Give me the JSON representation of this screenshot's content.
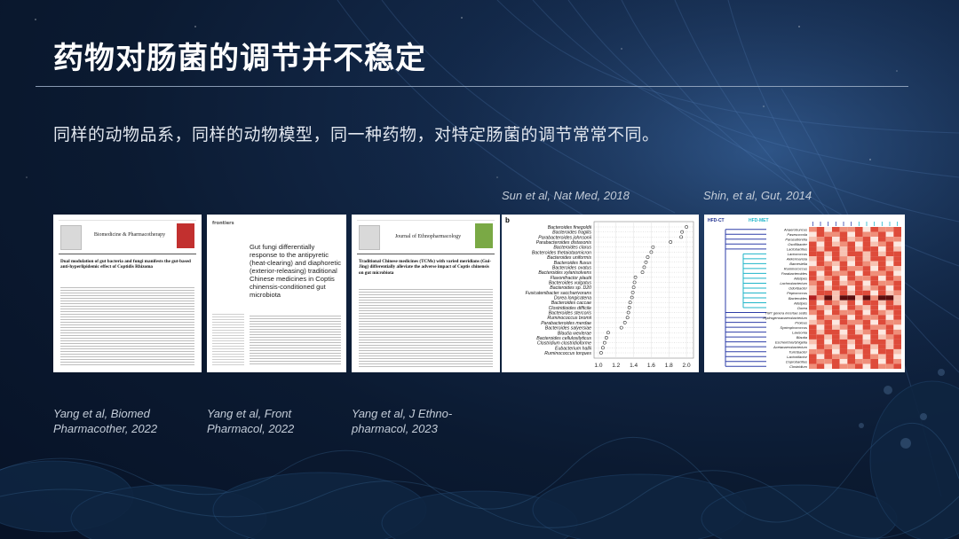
{
  "slide": {
    "title": "药物对肠菌的调节并不稳定",
    "subtitle": "同样的动物品系，同样的动物模型，同一种药物，对特定肠菌的调节常常不同。"
  },
  "papers": [
    {
      "caption_line1": "Yang et al, Biomed",
      "caption_line2": "Pharmacother, 2022",
      "journal": "Biomedicine & Pharmacotherapy",
      "article_title": "Dual modulation of gut bacteria and fungi manifests the gut-based anti-hyperlipidemic effect of Coptidis Rhizoma"
    },
    {
      "caption_line1": "Yang et al, Front",
      "caption_line2": "Pharmacol, 2022",
      "publisher": "frontiers",
      "article_title": "Gut fungi differentially response to the antipyretic (heat-clearing) and diaphoretic (exterior-releasing) traditional Chinese medicines in Coptis chinensis-conditioned gut microbiota"
    },
    {
      "caption_line1": "Yang et al, J Ethno-",
      "caption_line2": "pharmacol, 2023",
      "journal": "Journal of Ethnopharmacology",
      "article_title": "Traditional Chinese medicines (TCMs) with varied meridians (Gui-Jing) differentially alleviate the adverse impact of Coptis chinensis on gut microbiota"
    }
  ],
  "figure_sun": {
    "caption": "Sun et al, Nat Med, 2018",
    "panel_label": "b",
    "chart_data": {
      "type": "scatter",
      "categories": [
        "Bacteroides finegoldii",
        "Bacteroides fragilis",
        "Parabacteroides johnsonii",
        "Parabacteroides distasonis",
        "Bacteroides clarus",
        "Bacteroides thetaiotaomicron",
        "Bacteroides uniformis",
        "Bacteroides fluxus",
        "Bacteroides ovatus",
        "Bacteroides xylanisolvens",
        "Flavonifractor plautii",
        "Bacteroides vulgatus",
        "Bacteroides sp. D20",
        "Fusicatenibacter saccharivorans",
        "Dorea longicatena",
        "Bacteroides caccae",
        "Clostridioides difficile",
        "Bacteroides stercoris",
        "Ruminococcus bromii",
        "Parabacteroides merdae",
        "Bacteroides salyersiae",
        "Blautia wexlerae",
        "Bacteroides cellulosilyticus",
        "Clostridium clostridioforme",
        "Eubacterium hallii",
        "Ruminococcus torques"
      ],
      "values": [
        2.0,
        1.95,
        1.94,
        1.82,
        1.62,
        1.6,
        1.56,
        1.54,
        1.52,
        1.5,
        1.42,
        1.41,
        1.4,
        1.39,
        1.38,
        1.36,
        1.35,
        1.34,
        1.33,
        1.3,
        1.26,
        1.11,
        1.09,
        1.07,
        1.05,
        1.03
      ],
      "xlim": [
        0.95,
        2.08
      ],
      "xticks": [
        "1.0",
        "1.2",
        "1.4",
        "1.6",
        "1.8",
        "2.0"
      ]
    }
  },
  "figure_shin": {
    "caption": "Shin, et al, Gut, 2014",
    "legend_left": "HFD-CT",
    "legend_mid": "HFD-MET",
    "chart_data": {
      "type": "heatmap",
      "rows": [
        "Anaerotruncus",
        "Pasesoccola",
        "Parasutterella",
        "Oscillibacter",
        "Lactobacillus",
        "Lactococcus",
        "Akkermansia",
        "Barnesiella",
        "Ruminococcus",
        "Parabacteroides",
        "Alistipes",
        "Lachnobacterium",
        "Odoribacter",
        "Peptococcus",
        "Bacteroides",
        "Alistipes",
        "Dorea",
        "TM7 genera incertae sedis",
        "Hydrogenoanaerobacterium",
        "Proteus",
        "Syntrophococcus",
        "Lawsonia",
        "Blautia",
        "Escherichia/Shigella",
        "Acetanaerobacterium",
        "Turicibacter",
        "Lactonifactor",
        "Coprobacillus",
        "Clostridium"
      ]
    }
  }
}
